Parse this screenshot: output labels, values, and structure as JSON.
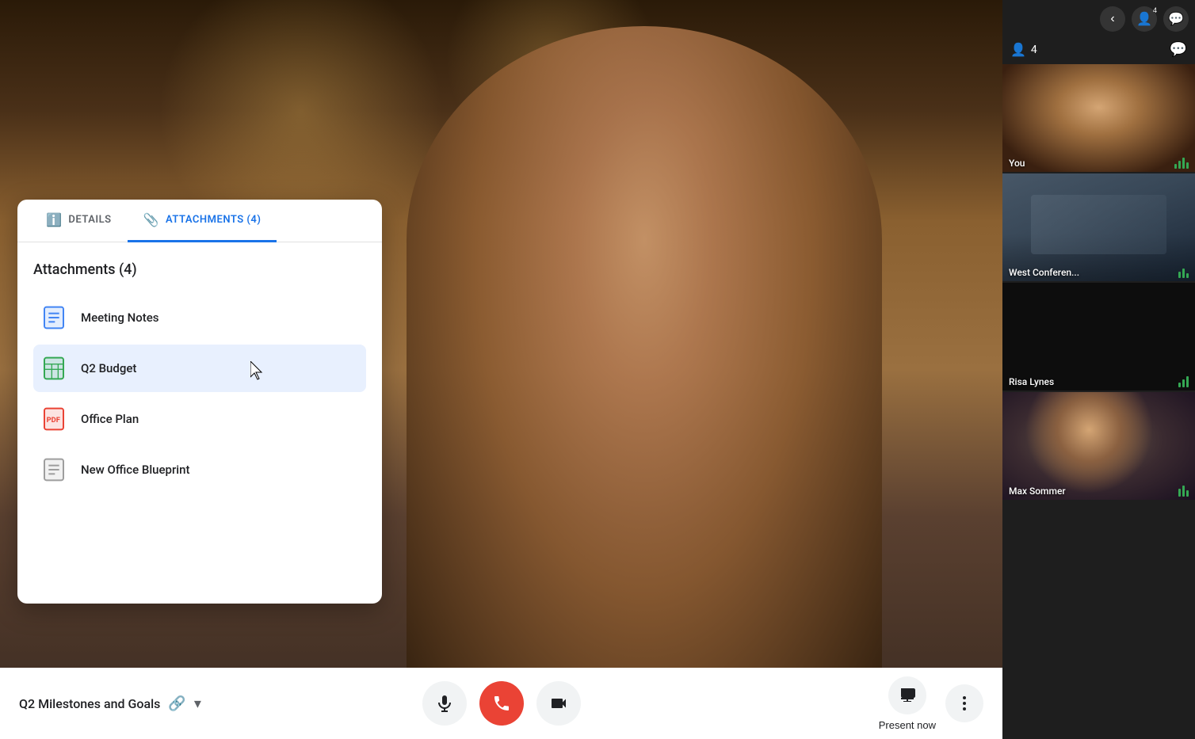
{
  "main": {
    "meeting_title": "Q2 Milestones and Goals"
  },
  "side_panel": {
    "collapse_label": "‹",
    "participant_count": "4",
    "tabs": [
      {
        "id": "people",
        "icon": "👤",
        "badge": "4"
      },
      {
        "id": "chat",
        "icon": "💬",
        "badge": ""
      }
    ],
    "participants": [
      {
        "id": "you",
        "label": "You",
        "has_audio": true
      },
      {
        "id": "west",
        "label": "West Conferen...",
        "has_audio": true
      },
      {
        "id": "risa",
        "label": "Risa Lynes",
        "has_audio": true
      },
      {
        "id": "max",
        "label": "Max Sommer",
        "has_audio": true
      }
    ]
  },
  "attachments_panel": {
    "tabs": [
      {
        "id": "details",
        "label": "Details",
        "active": false
      },
      {
        "id": "attachments",
        "label": "Attachments (4)",
        "active": true
      }
    ],
    "title": "Attachments (4)",
    "items": [
      {
        "id": "meeting-notes",
        "name": "Meeting Notes",
        "type": "doc"
      },
      {
        "id": "q2-budget",
        "name": "Q2 Budget",
        "type": "sheet",
        "highlighted": true
      },
      {
        "id": "office-plan",
        "name": "Office Plan",
        "type": "pdf"
      },
      {
        "id": "new-office-blueprint",
        "name": "New Office Blueprint",
        "type": "blueprint"
      }
    ]
  },
  "bottom_bar": {
    "meeting_title": "Q2 Milestones and Goals",
    "present_now_label": "Present now",
    "controls": {
      "mic_label": "Microphone",
      "end_call_label": "End call",
      "camera_label": "Camera"
    }
  }
}
